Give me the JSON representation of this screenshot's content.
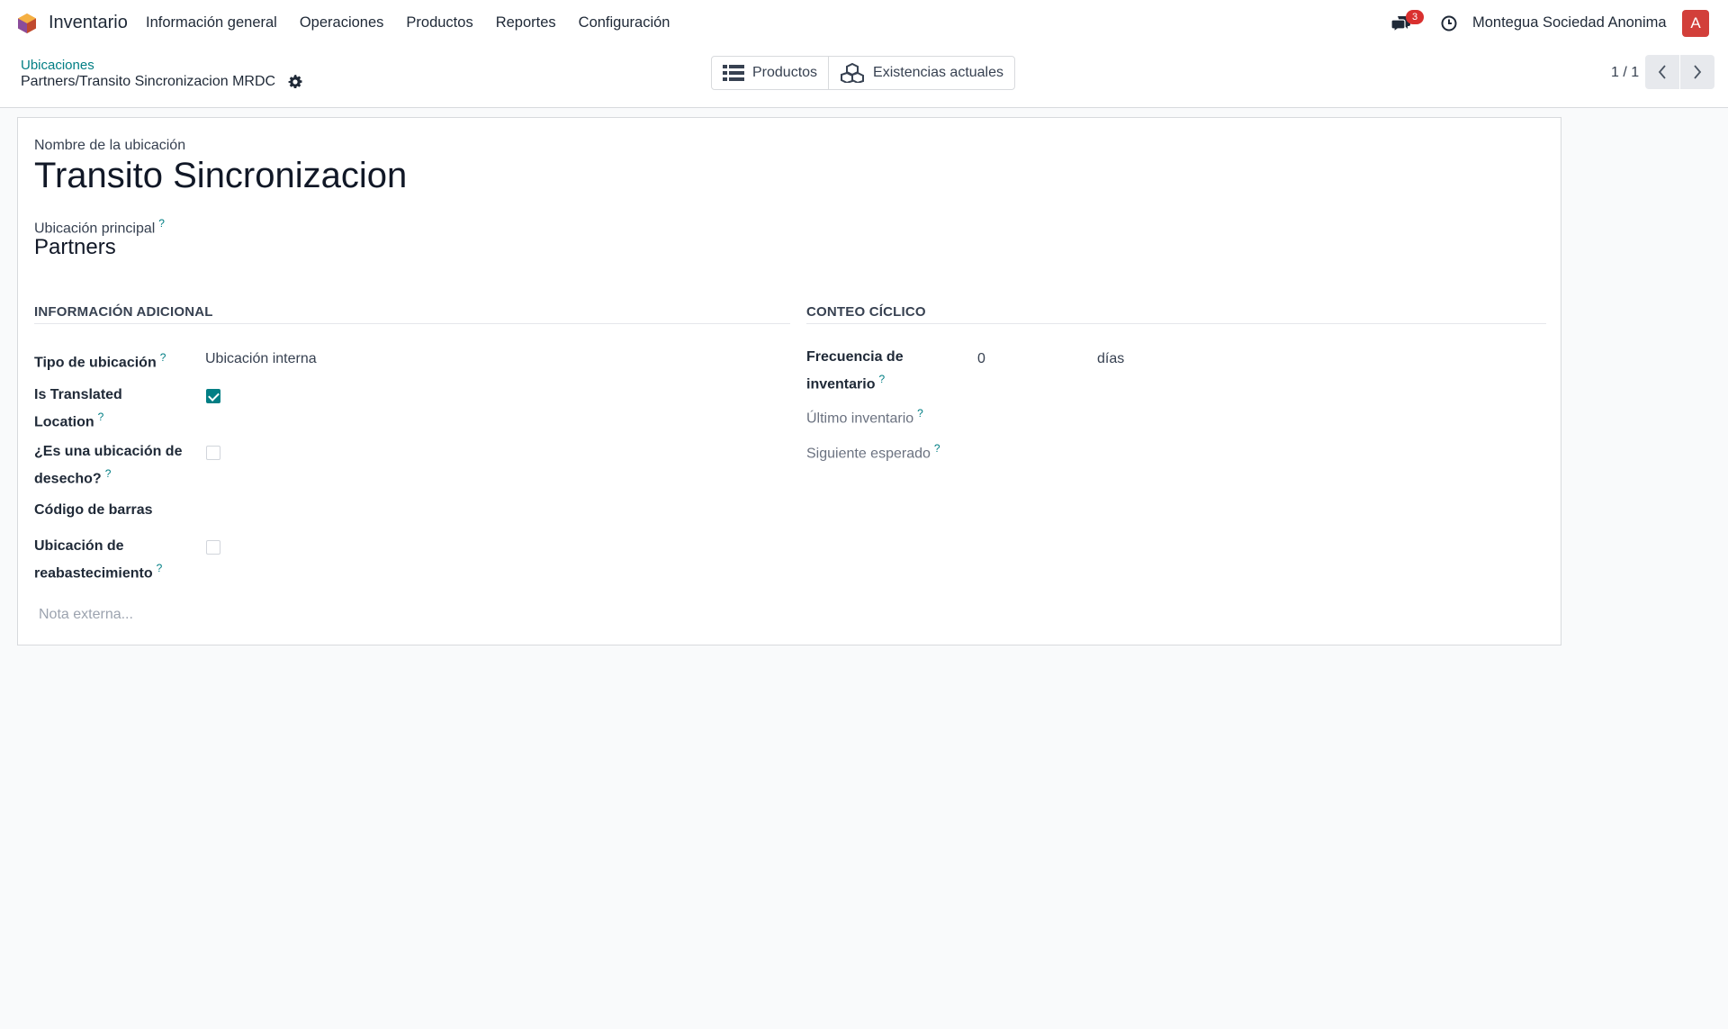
{
  "navbar": {
    "app_name": "Inventario",
    "menu": [
      "Información general",
      "Operaciones",
      "Productos",
      "Reportes",
      "Configuración"
    ],
    "chat_count": "3",
    "company": "Montegua Sociedad Anonima",
    "avatar_letter": "A"
  },
  "breadcrumb": {
    "parent": "Ubicaciones",
    "current": "Partners/Transito Sincronizacion MRDC"
  },
  "smart_buttons": {
    "products": "Productos",
    "stock": "Existencias actuales"
  },
  "pager": {
    "value": "1 / 1"
  },
  "form": {
    "name_label": "Nombre de la ubicación",
    "name_value": "Transito Sincronizacion",
    "parent_label": "Ubicación principal",
    "parent_value": "Partners",
    "help_mark": "?",
    "section_additional": "INFORMACIÓN ADICIONAL",
    "section_cycle": "CONTEO CÍCLICO",
    "location_type_label": "Tipo de ubicación",
    "location_type_value": "Ubicación interna",
    "translated_label_1": "Is Translated",
    "translated_label_2": "Location",
    "translated_checked": true,
    "scrap_label_1": "¿Es una ubicación de",
    "scrap_label_2": "desecho?",
    "scrap_checked": false,
    "barcode_label": "Código de barras",
    "replenish_label_1": "Ubicación de",
    "replenish_label_2": "reabastecimiento",
    "replenish_checked": false,
    "frequency_label_1": "Frecuencia de",
    "frequency_label_2": "inventario",
    "frequency_value": "0",
    "frequency_unit": "días",
    "last_inventory_label": "Último inventario",
    "next_expected_label": "Siguiente esperado",
    "note_placeholder": "Nota externa..."
  },
  "colors": {
    "accent": "#017e84",
    "brand": "#714b67",
    "badge": "#d9302f"
  }
}
